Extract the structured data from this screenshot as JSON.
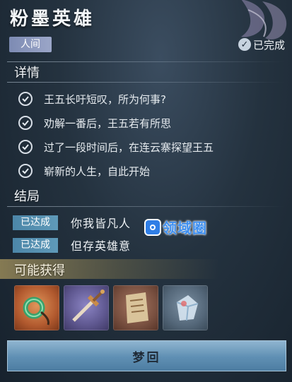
{
  "header": {
    "title": "粉墨英雄",
    "tag": "人间",
    "status": "已完成"
  },
  "details": {
    "heading": "详情",
    "items": [
      {
        "text": "王五长吁短叹，所为何事?"
      },
      {
        "text": "劝解一番后，王五若有所思"
      },
      {
        "text": "过了一段时间后，在连云寨探望王五"
      },
      {
        "text": "崭新的人生，自此开始"
      }
    ]
  },
  "ending": {
    "heading": "结局",
    "items": [
      {
        "badge": "已达成",
        "text": "你我皆凡人"
      },
      {
        "badge": "已达成",
        "text": "但存英雄意"
      }
    ]
  },
  "watermark": "领域圈",
  "rewards": {
    "heading": "可能获得",
    "items": [
      {
        "icon": "jade-ring-icon",
        "color": "#b25a2f"
      },
      {
        "icon": "sword-hilt-icon",
        "color": "#5e578f"
      },
      {
        "icon": "old-manuscript-icon",
        "color": "#7a5141"
      },
      {
        "icon": "crystal-gem-icon",
        "color": "#55687a"
      }
    ]
  },
  "action": {
    "label": "梦回"
  }
}
